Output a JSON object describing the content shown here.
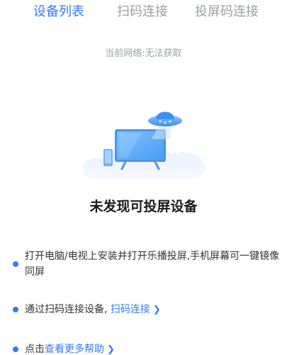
{
  "tabs": [
    {
      "label": "设备列表",
      "active": true
    },
    {
      "label": "扫码连接",
      "active": false
    },
    {
      "label": "投屏码连接",
      "active": false
    }
  ],
  "network": {
    "status_text": "当前网络:无法获取"
  },
  "empty_state": {
    "title": "未发现可投屏设备",
    "illustration": "tv-ufo-illustration"
  },
  "tips": {
    "tip1_text": "打开电脑/电视上安装并打开乐播投屏,手机屏幕可一键镜像同屏",
    "tip2_prefix": "通过扫码连接设备,",
    "tip2_link": "扫码连接",
    "tip3_prefix": "点击",
    "tip3_link": "查看更多帮助"
  },
  "icons": {
    "chevron": "chevron-right-icon",
    "bullet": "bullet-dot-icon"
  },
  "colors": {
    "accent": "#2f7df6",
    "muted": "#9aa0a6",
    "text": "#333333"
  }
}
